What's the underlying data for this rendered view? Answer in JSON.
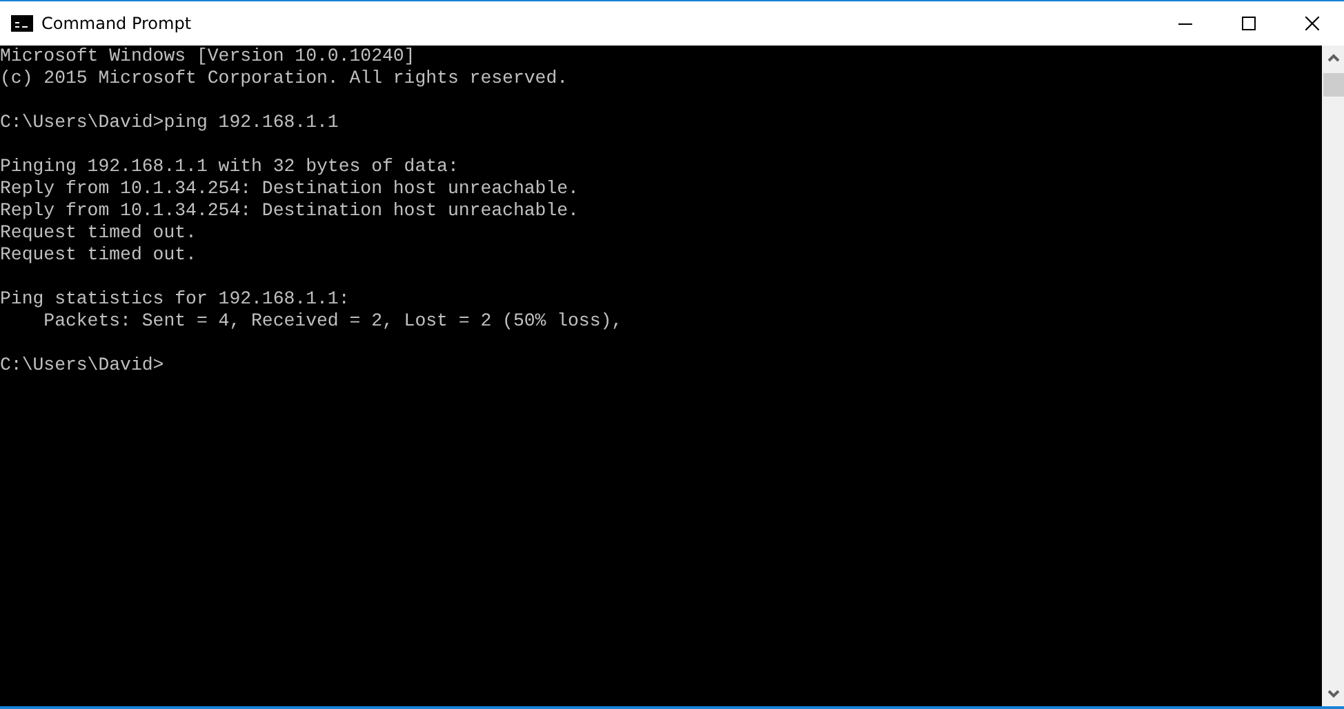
{
  "window": {
    "title": "Command Prompt"
  },
  "console": {
    "blocks": [
      [
        "Microsoft Windows [Version 10.0.10240]",
        "(c) 2015 Microsoft Corporation. All rights reserved."
      ],
      [
        "C:\\Users\\David>ping 192.168.1.1"
      ],
      [
        "Pinging 192.168.1.1 with 32 bytes of data:",
        "Reply from 10.1.34.254: Destination host unreachable.",
        "Reply from 10.1.34.254: Destination host unreachable.",
        "Request timed out.",
        "Request timed out."
      ],
      [
        "Ping statistics for 192.168.1.1:",
        "    Packets: Sent = 4, Received = 2, Lost = 2 (50% loss),"
      ],
      [
        "C:\\Users\\David>"
      ]
    ]
  }
}
